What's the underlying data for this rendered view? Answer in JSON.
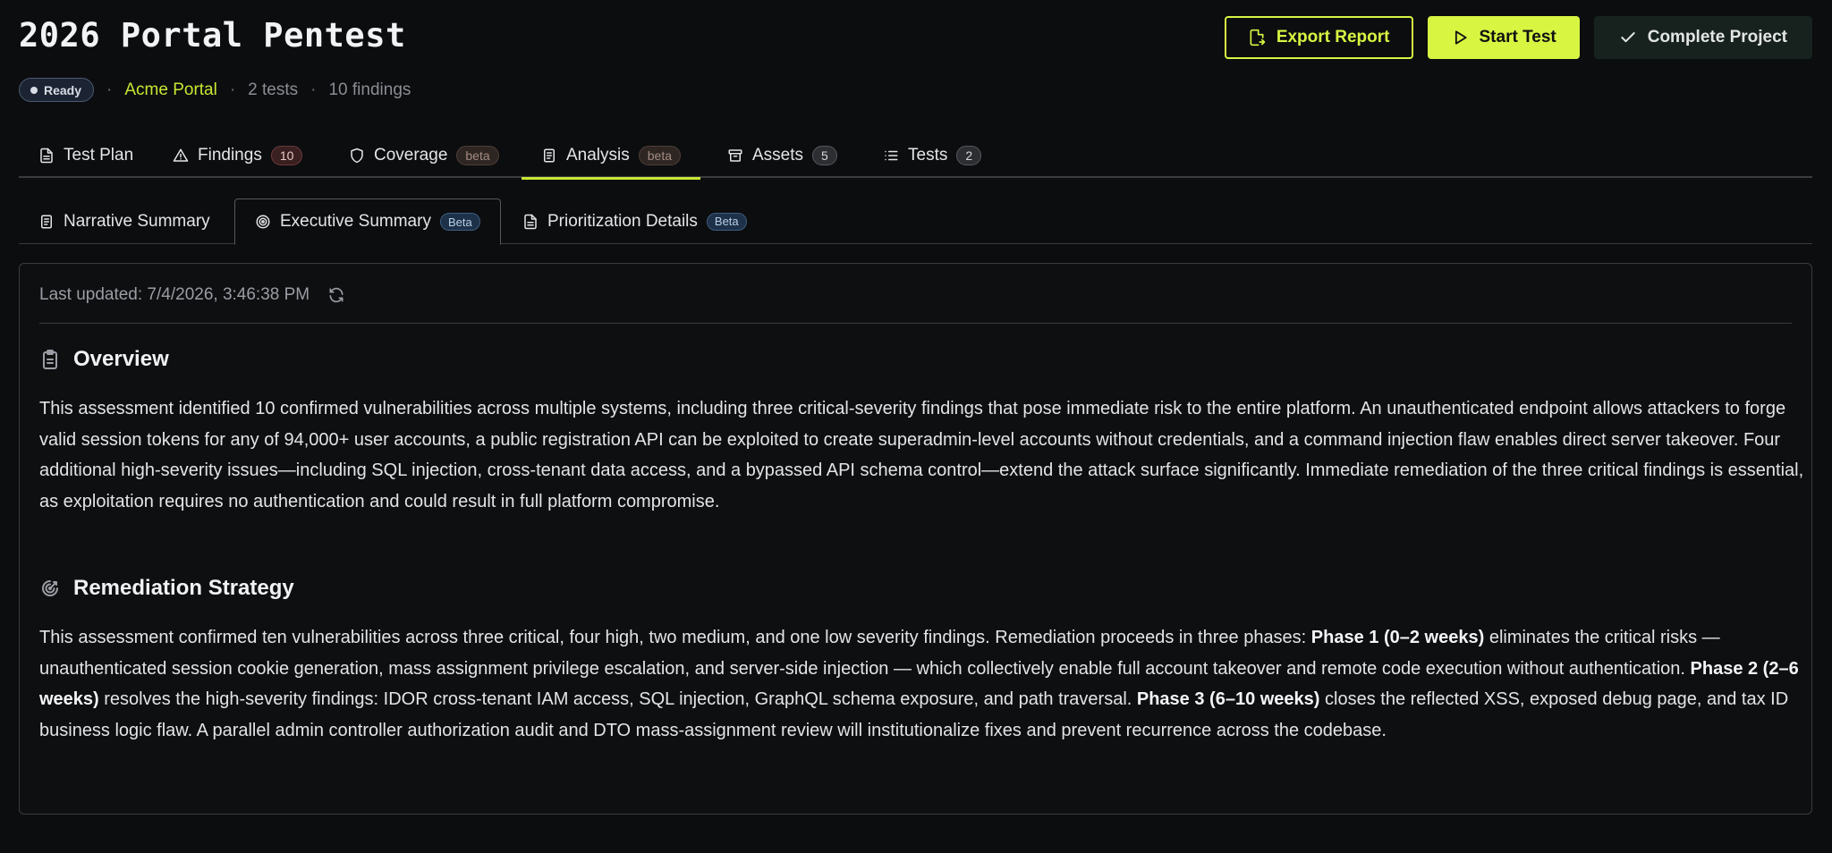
{
  "project": {
    "title": "2026 Portal Pentest",
    "status": "Ready",
    "name": "Acme Portal",
    "tests_count": "2 tests",
    "findings_count": "10 findings"
  },
  "actions": {
    "export": "Export Report",
    "start": "Start Test",
    "complete": "Complete Project"
  },
  "tabs": [
    {
      "label": "Test Plan",
      "icon": "document-icon"
    },
    {
      "label": "Findings",
      "badge": "10",
      "icon": "warning-icon"
    },
    {
      "label": "Coverage",
      "badge": "beta",
      "icon": "shield-icon"
    },
    {
      "label": "Analysis",
      "badge": "beta",
      "icon": "document-icon",
      "active": true
    },
    {
      "label": "Assets",
      "badge": "5",
      "icon": "archive-icon"
    },
    {
      "label": "Tests",
      "badge": "2",
      "icon": "list-icon"
    }
  ],
  "subtabs": [
    {
      "label": "Narrative Summary",
      "icon": "document-icon"
    },
    {
      "label": "Executive Summary",
      "badge": "Beta",
      "icon": "target-icon",
      "active": true
    },
    {
      "label": "Prioritization Details",
      "badge": "Beta",
      "icon": "file-icon"
    }
  ],
  "summary": {
    "last_updated": "Last updated: 7/4/2026, 3:46:38 PM",
    "overview": {
      "heading": "Overview",
      "text": "This assessment identified 10 confirmed vulnerabilities across multiple systems, including three critical-severity findings that pose immediate risk to the entire platform. An unauthenticated endpoint allows attackers to forge valid session tokens for any of 94,000+ user accounts, a public registration API can be exploited to create superadmin-level accounts without credentials, and a command injection flaw enables direct server takeover. Four additional high-severity issues—including SQL injection, cross-tenant data access, and a bypassed API schema control—extend the attack surface significantly. Immediate remediation of the three critical findings is essential, as exploitation requires no authentication and could result in full platform compromise."
    },
    "remediation": {
      "heading": "Remediation Strategy",
      "intro": "This assessment confirmed ten vulnerabilities across three critical, four high, two medium, and one low severity findings. Remediation proceeds in three phases: ",
      "phase1_label": "Phase 1 (0–2 weeks)",
      "phase1_text": " eliminates the critical risks — unauthenticated session cookie generation, mass assignment privilege escalation, and server-side injection — which collectively enable full account takeover and remote code execution without authentication. ",
      "phase2_label": "Phase 2 (2–6 weeks)",
      "phase2_text": " resolves the high-severity findings: IDOR cross-tenant IAM access, SQL injection, GraphQL schema exposure, and path traversal. ",
      "phase3_label": "Phase 3 (6–10 weeks)",
      "phase3_text": " closes the reflected XSS, exposed debug page, and tax ID business logic flaw. A parallel admin controller authorization audit and DTO mass-assignment review will institutionalize fixes and prevent recurrence across the codebase."
    }
  },
  "colors": {
    "accent": "#d8f542",
    "background": "#0c0d0f"
  }
}
